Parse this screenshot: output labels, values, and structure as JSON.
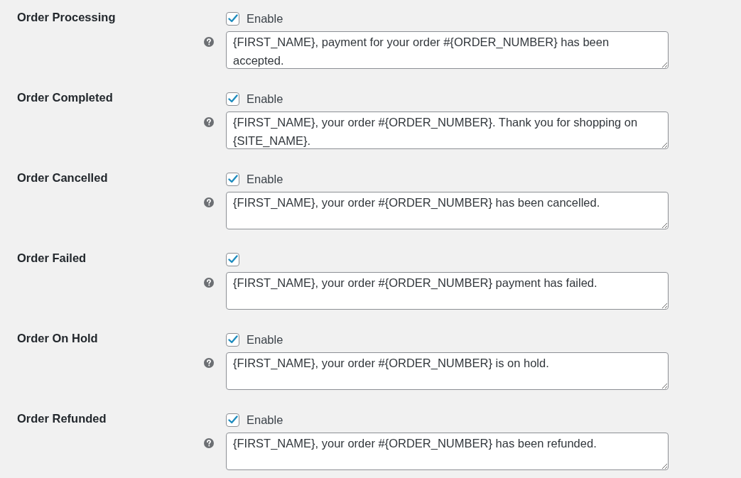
{
  "notifications": [
    {
      "title": "Order Processing",
      "checked": true,
      "checkbox_label": "Enable",
      "message": "{FIRST_NAME}, payment for your order #{ORDER_NUMBER} has been accepted."
    },
    {
      "title": "Order Completed",
      "checked": true,
      "checkbox_label": "Enable",
      "message": "{FIRST_NAME}, your order #{ORDER_NUMBER}. Thank you for shopping on {SITE_NAME}."
    },
    {
      "title": "Order Cancelled",
      "checked": true,
      "checkbox_label": "Enable",
      "message": "{FIRST_NAME}, your order #{ORDER_NUMBER} has been cancelled."
    },
    {
      "title": "Order Failed",
      "checked": true,
      "message": "{FIRST_NAME}, your order #{ORDER_NUMBER} payment has failed."
    },
    {
      "title": "Order On Hold",
      "checked": true,
      "checkbox_label": "Enable",
      "message": "{FIRST_NAME}, your order #{ORDER_NUMBER} is on hold."
    },
    {
      "title": "Order Refunded",
      "checked": true,
      "checkbox_label": "Enable",
      "message": "{FIRST_NAME}, your order #{ORDER_NUMBER} has been refunded."
    }
  ]
}
